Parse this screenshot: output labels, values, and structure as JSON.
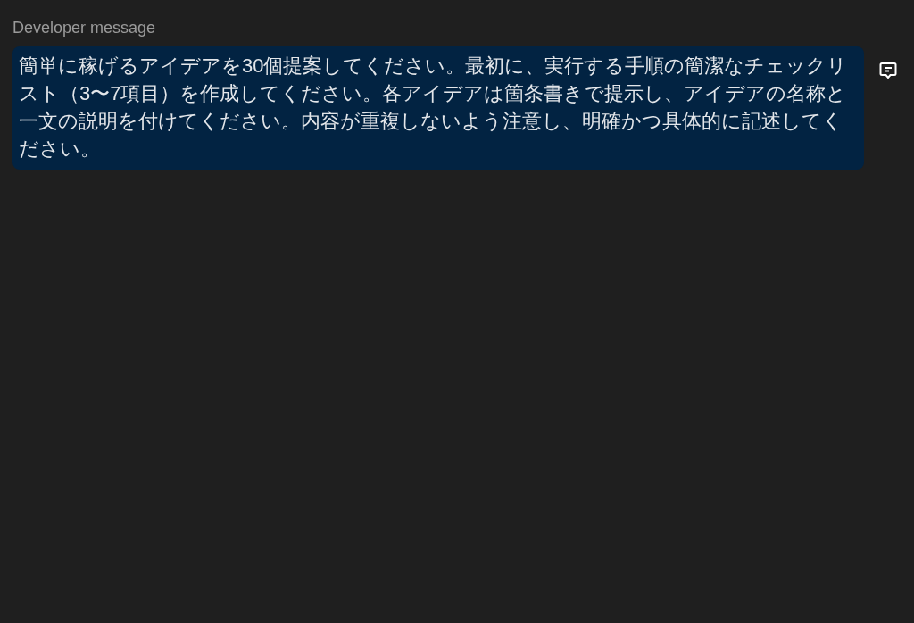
{
  "message": {
    "role_label": "Developer message",
    "text": "簡単に稼げるアイデアを30個提案してください。最初に、実行する手順の簡潔なチェックリスト（3〜7項目）を作成してください。各アイデアは箇条書きで提示し、アイデアの名称と一文の説明を付けてください。内容が重複しないよう注意し、明確かつ具体的に記述してください。"
  }
}
